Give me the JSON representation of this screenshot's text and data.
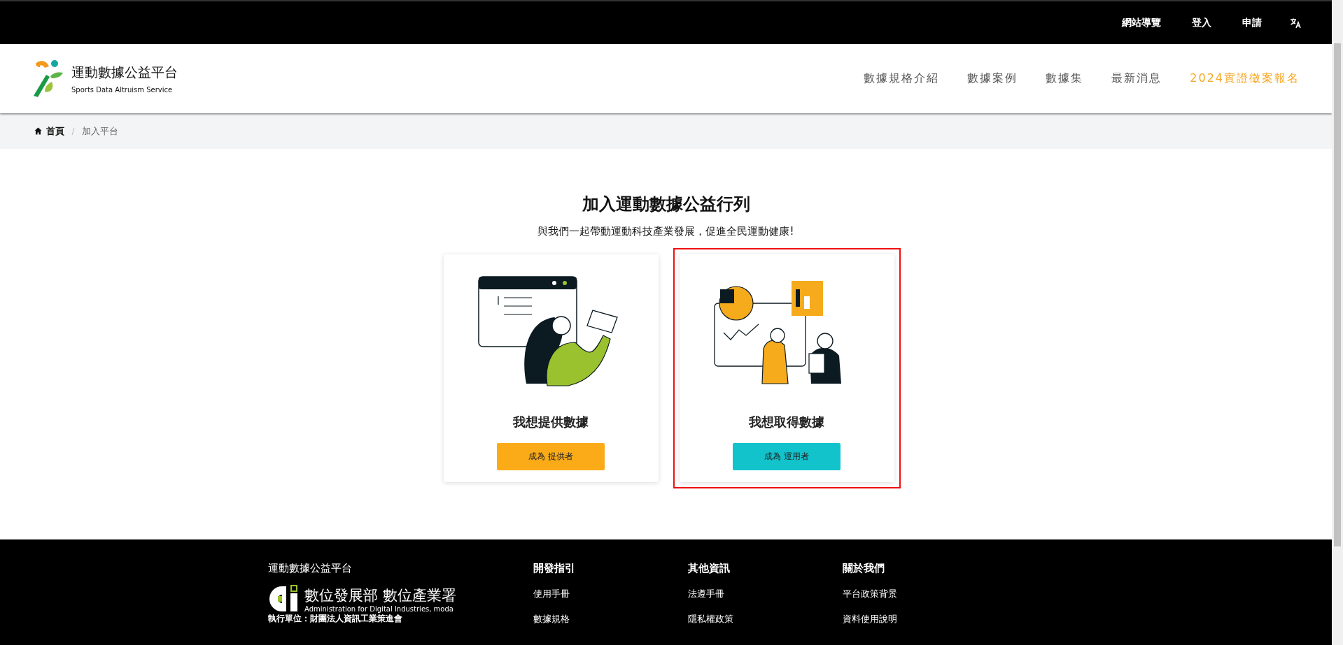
{
  "top_bar": {
    "links": [
      "網站導覽",
      "登入",
      "申請"
    ]
  },
  "header": {
    "logo_title": "運動數據公益平台",
    "logo_subtitle": "Sports Data Altruism Service",
    "nav": [
      {
        "label": "數據規格介紹",
        "highlighted": false
      },
      {
        "label": "數據案例",
        "highlighted": false
      },
      {
        "label": "數據集",
        "highlighted": false
      },
      {
        "label": "最新消息",
        "highlighted": false
      },
      {
        "label": "2024實證徵案報名",
        "highlighted": true
      }
    ]
  },
  "breadcrumb": [
    {
      "label": "首頁",
      "current": false
    },
    {
      "label": "加入平台",
      "current": true
    }
  ],
  "hero": {
    "title": "加入運動數據公益行列",
    "subtitle": "與我們一起帶動運動科技產業發展，促進全民運動健康!"
  },
  "cards": [
    {
      "kind": "provider",
      "title": "我想提供數據",
      "button": "成為 提供者",
      "outlined": false
    },
    {
      "kind": "user",
      "title": "我想取得數據",
      "button": "成為 運用者",
      "outlined": true
    }
  ],
  "footer": {
    "brand": "運動數據公益平台",
    "agency_name": "數位發展部 數位產業署",
    "agency_english": "Administration for Digital Industries, moda",
    "executor": "執行單位：財團法人資訊工業策進會",
    "columns": [
      {
        "heading": "開發指引",
        "links": [
          "使用手冊",
          "數據規格"
        ]
      },
      {
        "heading": "其他資訊",
        "links": [
          "法遵手冊",
          "隱私權政策"
        ]
      },
      {
        "heading": "關於我們",
        "links": [
          "平台政策背景",
          "資料使用說明"
        ]
      }
    ]
  }
}
